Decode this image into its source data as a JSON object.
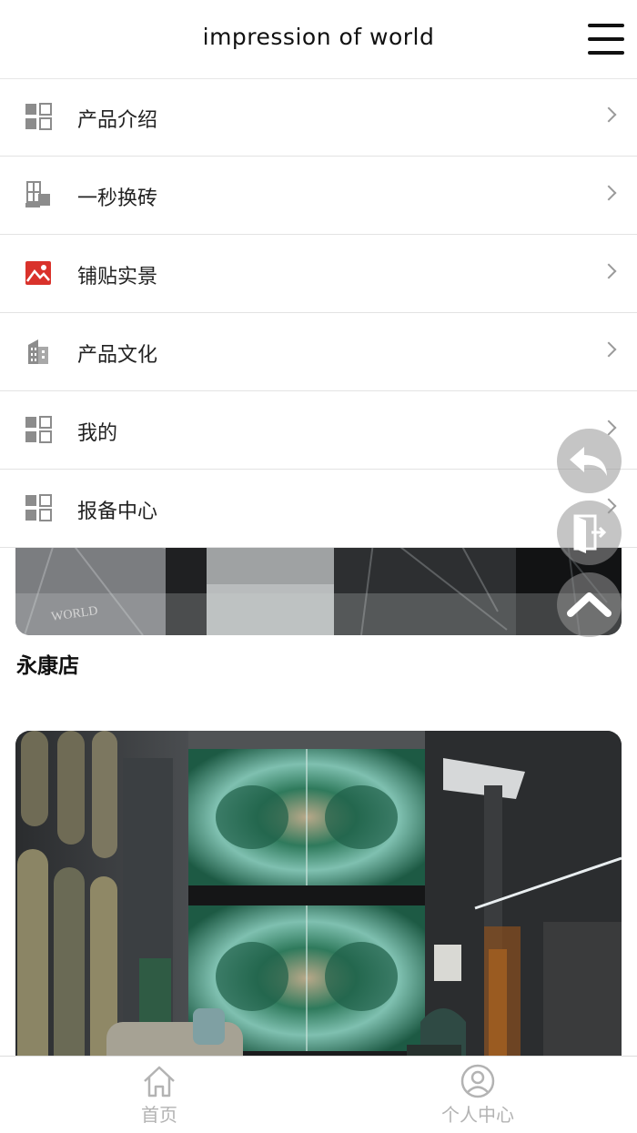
{
  "header": {
    "title": "impression of world",
    "menu_icon": "hamburger-menu-icon"
  },
  "menu": {
    "items": [
      {
        "label": "产品介绍",
        "icon": "grid-icon"
      },
      {
        "label": "一秒换砖",
        "icon": "tiles-icon"
      },
      {
        "label": "铺贴实景",
        "icon": "image-icon",
        "icon_color": "#d9322b"
      },
      {
        "label": "产品文化",
        "icon": "building-icon"
      },
      {
        "label": "我的",
        "icon": "grid-icon"
      },
      {
        "label": "报备中心",
        "icon": "grid-icon"
      }
    ]
  },
  "stores": [
    {
      "name": "永康店"
    }
  ],
  "floating_buttons": [
    "back-icon",
    "exit-icon",
    "scroll-top-icon"
  ],
  "tabbar": {
    "items": [
      {
        "label": "首页",
        "icon": "home-icon"
      },
      {
        "label": "个人中心",
        "icon": "user-icon"
      }
    ]
  },
  "colors": {
    "accent_red": "#d9322b",
    "icon_gray": "#8c8c8c",
    "tab_gray": "#b3b3b3"
  }
}
